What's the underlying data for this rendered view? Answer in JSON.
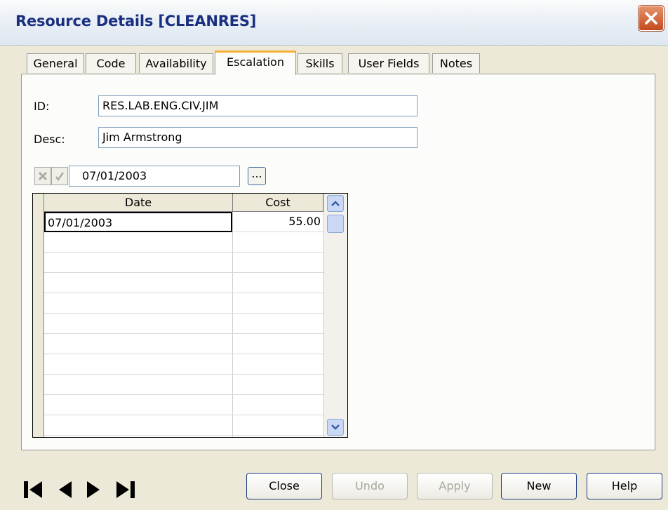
{
  "window": {
    "title": "Resource Details [CLEANRES]"
  },
  "tabs": [
    {
      "label": "General"
    },
    {
      "label": "Code"
    },
    {
      "label": "Availability"
    },
    {
      "label": "Escalation",
      "active": true
    },
    {
      "label": "Skills"
    },
    {
      "label": "User Fields"
    },
    {
      "label": "Notes"
    }
  ],
  "form": {
    "id_label": "ID:",
    "id_value": "RES.LAB.ENG.CIV.JIM",
    "desc_label": "Desc:",
    "desc_value": "Jim Armstrong",
    "date_edit_value": "07/01/2003",
    "ellipsis_label": "..."
  },
  "grid": {
    "columns": [
      "Date",
      "Cost"
    ],
    "rows": [
      {
        "date": "07/01/2003",
        "cost": "55.00"
      }
    ]
  },
  "buttons": {
    "close": "Close",
    "undo": "Undo",
    "apply": "Apply",
    "new": "New",
    "help": "Help"
  },
  "colors": {
    "title_text": "#1a2f80",
    "active_tab_accent": "#f5b035",
    "close_button": "#c3491d"
  }
}
